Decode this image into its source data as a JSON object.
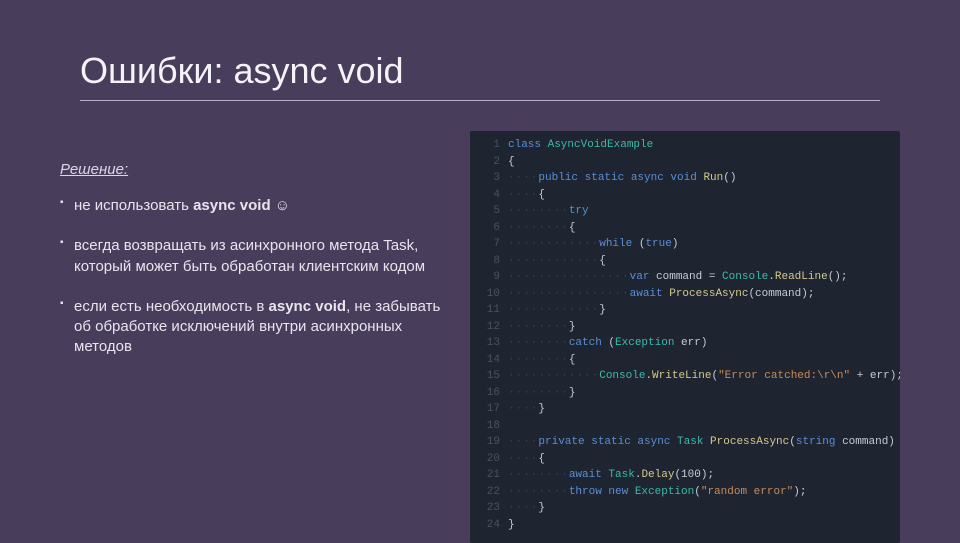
{
  "title": "Ошибки: async void",
  "solution_label": "Решение:",
  "bullets": [
    {
      "pre": "не использовать ",
      "bold": "async void",
      "post": " ☺"
    },
    {
      "pre": "всегда возвращать из асинхронного метода Task, который может быть обработан клиентским кодом",
      "bold": "",
      "post": ""
    },
    {
      "pre": "если есть необходимость в ",
      "bold": "async void",
      "post": ", не забывать об обработке исключений внутри асинхронных методов"
    }
  ],
  "code": [
    {
      "n": "1",
      "dots": "",
      "tokens": [
        [
          "kw",
          "class "
        ],
        [
          "cls",
          "AsyncVoidExample"
        ]
      ]
    },
    {
      "n": "2",
      "dots": "",
      "tokens": [
        [
          "punct",
          "{"
        ]
      ]
    },
    {
      "n": "3",
      "dots": "····",
      "tokens": [
        [
          "kw",
          "public static async void "
        ],
        [
          "mtd",
          "Run"
        ],
        [
          "punct",
          "()"
        ]
      ]
    },
    {
      "n": "4",
      "dots": "····",
      "tokens": [
        [
          "punct",
          "{"
        ]
      ]
    },
    {
      "n": "5",
      "dots": "········",
      "tokens": [
        [
          "kw",
          "try"
        ]
      ]
    },
    {
      "n": "6",
      "dots": "········",
      "tokens": [
        [
          "punct",
          "{"
        ]
      ]
    },
    {
      "n": "7",
      "dots": "············",
      "tokens": [
        [
          "kw",
          "while "
        ],
        [
          "punct",
          "("
        ],
        [
          "kw",
          "true"
        ],
        [
          "punct",
          ")"
        ]
      ]
    },
    {
      "n": "8",
      "dots": "············",
      "tokens": [
        [
          "punct",
          "{"
        ]
      ]
    },
    {
      "n": "9",
      "dots": "················",
      "tokens": [
        [
          "kw",
          "var "
        ],
        [
          "punct",
          "command = "
        ],
        [
          "cls",
          "Console"
        ],
        [
          "punct",
          "."
        ],
        [
          "mtd",
          "ReadLine"
        ],
        [
          "punct",
          "();"
        ]
      ]
    },
    {
      "n": "10",
      "dots": "················",
      "tokens": [
        [
          "kw",
          "await "
        ],
        [
          "mtd",
          "ProcessAsync"
        ],
        [
          "punct",
          "(command);"
        ]
      ]
    },
    {
      "n": "11",
      "dots": "············",
      "tokens": [
        [
          "punct",
          "}"
        ]
      ]
    },
    {
      "n": "12",
      "dots": "········",
      "tokens": [
        [
          "punct",
          "}"
        ]
      ]
    },
    {
      "n": "13",
      "dots": "········",
      "tokens": [
        [
          "kw",
          "catch "
        ],
        [
          "punct",
          "("
        ],
        [
          "cls",
          "Exception"
        ],
        [
          "punct",
          " err)"
        ]
      ]
    },
    {
      "n": "14",
      "dots": "········",
      "tokens": [
        [
          "punct",
          "{"
        ]
      ]
    },
    {
      "n": "15",
      "dots": "············",
      "tokens": [
        [
          "cls",
          "Console"
        ],
        [
          "punct",
          "."
        ],
        [
          "mtd",
          "WriteLine"
        ],
        [
          "punct",
          "("
        ],
        [
          "str",
          "\"Error catched:\\r\\n\""
        ],
        [
          "punct",
          " + err);"
        ]
      ]
    },
    {
      "n": "16",
      "dots": "········",
      "tokens": [
        [
          "punct",
          "}"
        ]
      ]
    },
    {
      "n": "17",
      "dots": "····",
      "tokens": [
        [
          "punct",
          "}"
        ]
      ]
    },
    {
      "n": "18",
      "dots": "",
      "tokens": []
    },
    {
      "n": "19",
      "dots": "····",
      "tokens": [
        [
          "kw",
          "private static async "
        ],
        [
          "cls",
          "Task "
        ],
        [
          "mtd",
          "ProcessAsync"
        ],
        [
          "punct",
          "("
        ],
        [
          "kw",
          "string"
        ],
        [
          "punct",
          " command)"
        ]
      ]
    },
    {
      "n": "20",
      "dots": "····",
      "tokens": [
        [
          "punct",
          "{"
        ]
      ]
    },
    {
      "n": "21",
      "dots": "········",
      "tokens": [
        [
          "kw",
          "await "
        ],
        [
          "cls",
          "Task"
        ],
        [
          "punct",
          "."
        ],
        [
          "mtd",
          "Delay"
        ],
        [
          "punct",
          "(100);"
        ]
      ]
    },
    {
      "n": "22",
      "dots": "········",
      "tokens": [
        [
          "kw",
          "throw new "
        ],
        [
          "cls",
          "Exception"
        ],
        [
          "punct",
          "("
        ],
        [
          "str",
          "\"random error\""
        ],
        [
          "punct",
          ");"
        ]
      ]
    },
    {
      "n": "23",
      "dots": "····",
      "tokens": [
        [
          "punct",
          "}"
        ]
      ]
    },
    {
      "n": "24",
      "dots": "",
      "tokens": [
        [
          "punct",
          "}"
        ]
      ]
    }
  ]
}
